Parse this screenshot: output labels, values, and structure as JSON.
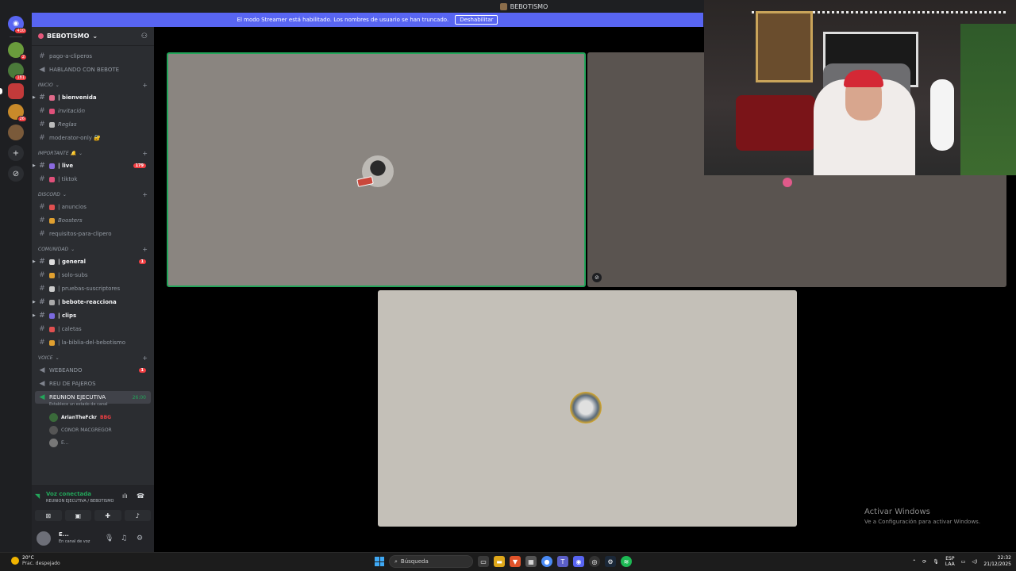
{
  "title_bar": {
    "server_name": "BEBOTISMO"
  },
  "banner": {
    "message": "El modo Streamer está habilitado. Los nombres de usuario se han truncado.",
    "button": "Deshabilitar"
  },
  "rail": {
    "top_badge": "410",
    "servers": [
      {
        "color": "#6a9c3c",
        "badge": "2"
      },
      {
        "color": "#4b7a3a",
        "badge": "181"
      },
      {
        "color": "#c33a3a",
        "badge": "",
        "selected": true
      },
      {
        "color": "#c98a2a",
        "badge": "26"
      },
      {
        "color": "#7a5a3a",
        "badge": ""
      }
    ],
    "add_icon": "plus-icon",
    "discover_icon": "compass-icon"
  },
  "sidebar": {
    "server_name": "BEBOTISMO",
    "top_channels": [
      {
        "name": "pago-a-cliperos",
        "icon": "hash"
      },
      {
        "name": "HABLANDO CON BEBOTE",
        "icon": "speaker"
      }
    ],
    "categories": [
      {
        "name": "INICIO",
        "channels": [
          {
            "name": "| bienvenida",
            "unread": true,
            "emoji_color": "#e06a8a"
          },
          {
            "name": "invitación",
            "emoji_color": "#e0507a",
            "italic": true
          },
          {
            "name": "Reglas",
            "emoji_color": "#bbb",
            "italic": true
          },
          {
            "name": "moderator-only 🔐",
            "emoji_color": ""
          }
        ]
      },
      {
        "name": "IMPORTANTE 🔔",
        "channels": [
          {
            "name": "| live",
            "unread": true,
            "emoji_color": "#8a6adf",
            "badge": "179"
          },
          {
            "name": "| tiktok",
            "emoji_color": "#e0507a"
          }
        ]
      },
      {
        "name": "DISCORD",
        "channels": [
          {
            "name": "| anuncios",
            "emoji_color": "#e05050"
          },
          {
            "name": "Boosters",
            "emoji_color": "#e0a030",
            "italic": true
          },
          {
            "name": "requisitos-para-clipero",
            "emoji_color": ""
          }
        ]
      },
      {
        "name": "COMUNIDAD",
        "channels": [
          {
            "name": "| general",
            "unread": true,
            "emoji_color": "#ddd",
            "badge": "1"
          },
          {
            "name": "| solo-subs",
            "emoji_color": "#e0a030"
          },
          {
            "name": "| pruebas-suscriptores",
            "emoji_color": "#ccc"
          },
          {
            "name": "| bebote-reacciona",
            "unread": true,
            "emoji_color": "#aaa"
          },
          {
            "name": "| clips",
            "unread": true,
            "emoji_color": "#7a6adf"
          },
          {
            "name": "| caletas",
            "emoji_color": "#e05050"
          },
          {
            "name": "| la-biblia-del-bebotismo",
            "emoji_color": "#e0a030"
          }
        ]
      },
      {
        "name": "VOICE",
        "channels": [
          {
            "name": "WEBEANDO",
            "badge": "1"
          },
          {
            "name": "REU DE PAJEROS"
          },
          {
            "name": "REUNION EJECUTIVA",
            "active": true,
            "timer": "26:00",
            "status": "Establece un estado de canal"
          }
        ]
      }
    ],
    "voice_users": [
      {
        "name": "ArianTheFckr",
        "tag": "BBG",
        "bold": true
      },
      {
        "name": "CONOR MACGREGOR",
        "bold": false
      },
      {
        "name": "E...",
        "bold": false
      }
    ]
  },
  "voice_bar": {
    "title": "Voz conectada",
    "subtitle": "REUNION EJECUTIVA / BEBOTISMO"
  },
  "user_panel": {
    "name": "E...",
    "status": "En canal de voz"
  },
  "watermark": {
    "title": "Activar Windows",
    "subtitle": "Ve a Configuración para activar Windows."
  },
  "taskbar": {
    "weather_temp": "20°C",
    "weather_desc": "Prac. despejado",
    "search_placeholder": "Búsqueda",
    "lang_top": "ESP",
    "lang_bottom": "LAA",
    "time": "22:32",
    "date": "21/12/2025"
  }
}
